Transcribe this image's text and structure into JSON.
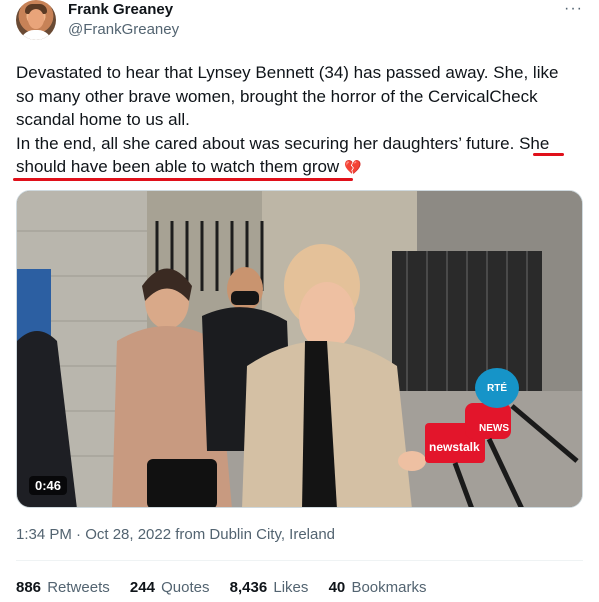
{
  "tweet": {
    "author_name": "Frank Greaney",
    "author_handle": "@FrankGreaney",
    "more_icon": "···",
    "text": {
      "line1": "Devastated to hear that Lynsey Bennett (34) has passed away. She, like",
      "line2": "so many other brave women, brought the horror of the CervicalCheck",
      "line3": "scandal home to us all.",
      "line4": "In the end, all she cared about was securing her daughters’ future. She",
      "line5": "should have been able to watch them grow",
      "emoji": "💔"
    },
    "media": {
      "duration": "0:46",
      "mic_labels": [
        "newstalk",
        "NEWS",
        "RTÉ"
      ]
    },
    "timestamp": "1:34 PM · Oct 28, 2022 from Dublin City, Ireland",
    "stats": {
      "retweets_count": "886",
      "retweets_label": "Retweets",
      "quotes_count": "244",
      "quotes_label": "Quotes",
      "likes_count": "8,436",
      "likes_label": "Likes",
      "bookmarks_count": "40",
      "bookmarks_label": "Bookmarks"
    }
  },
  "colors": {
    "text_primary": "#0f1419",
    "text_secondary": "#536471",
    "annotation_red": "#e0101a",
    "heart": "#e0245e"
  }
}
